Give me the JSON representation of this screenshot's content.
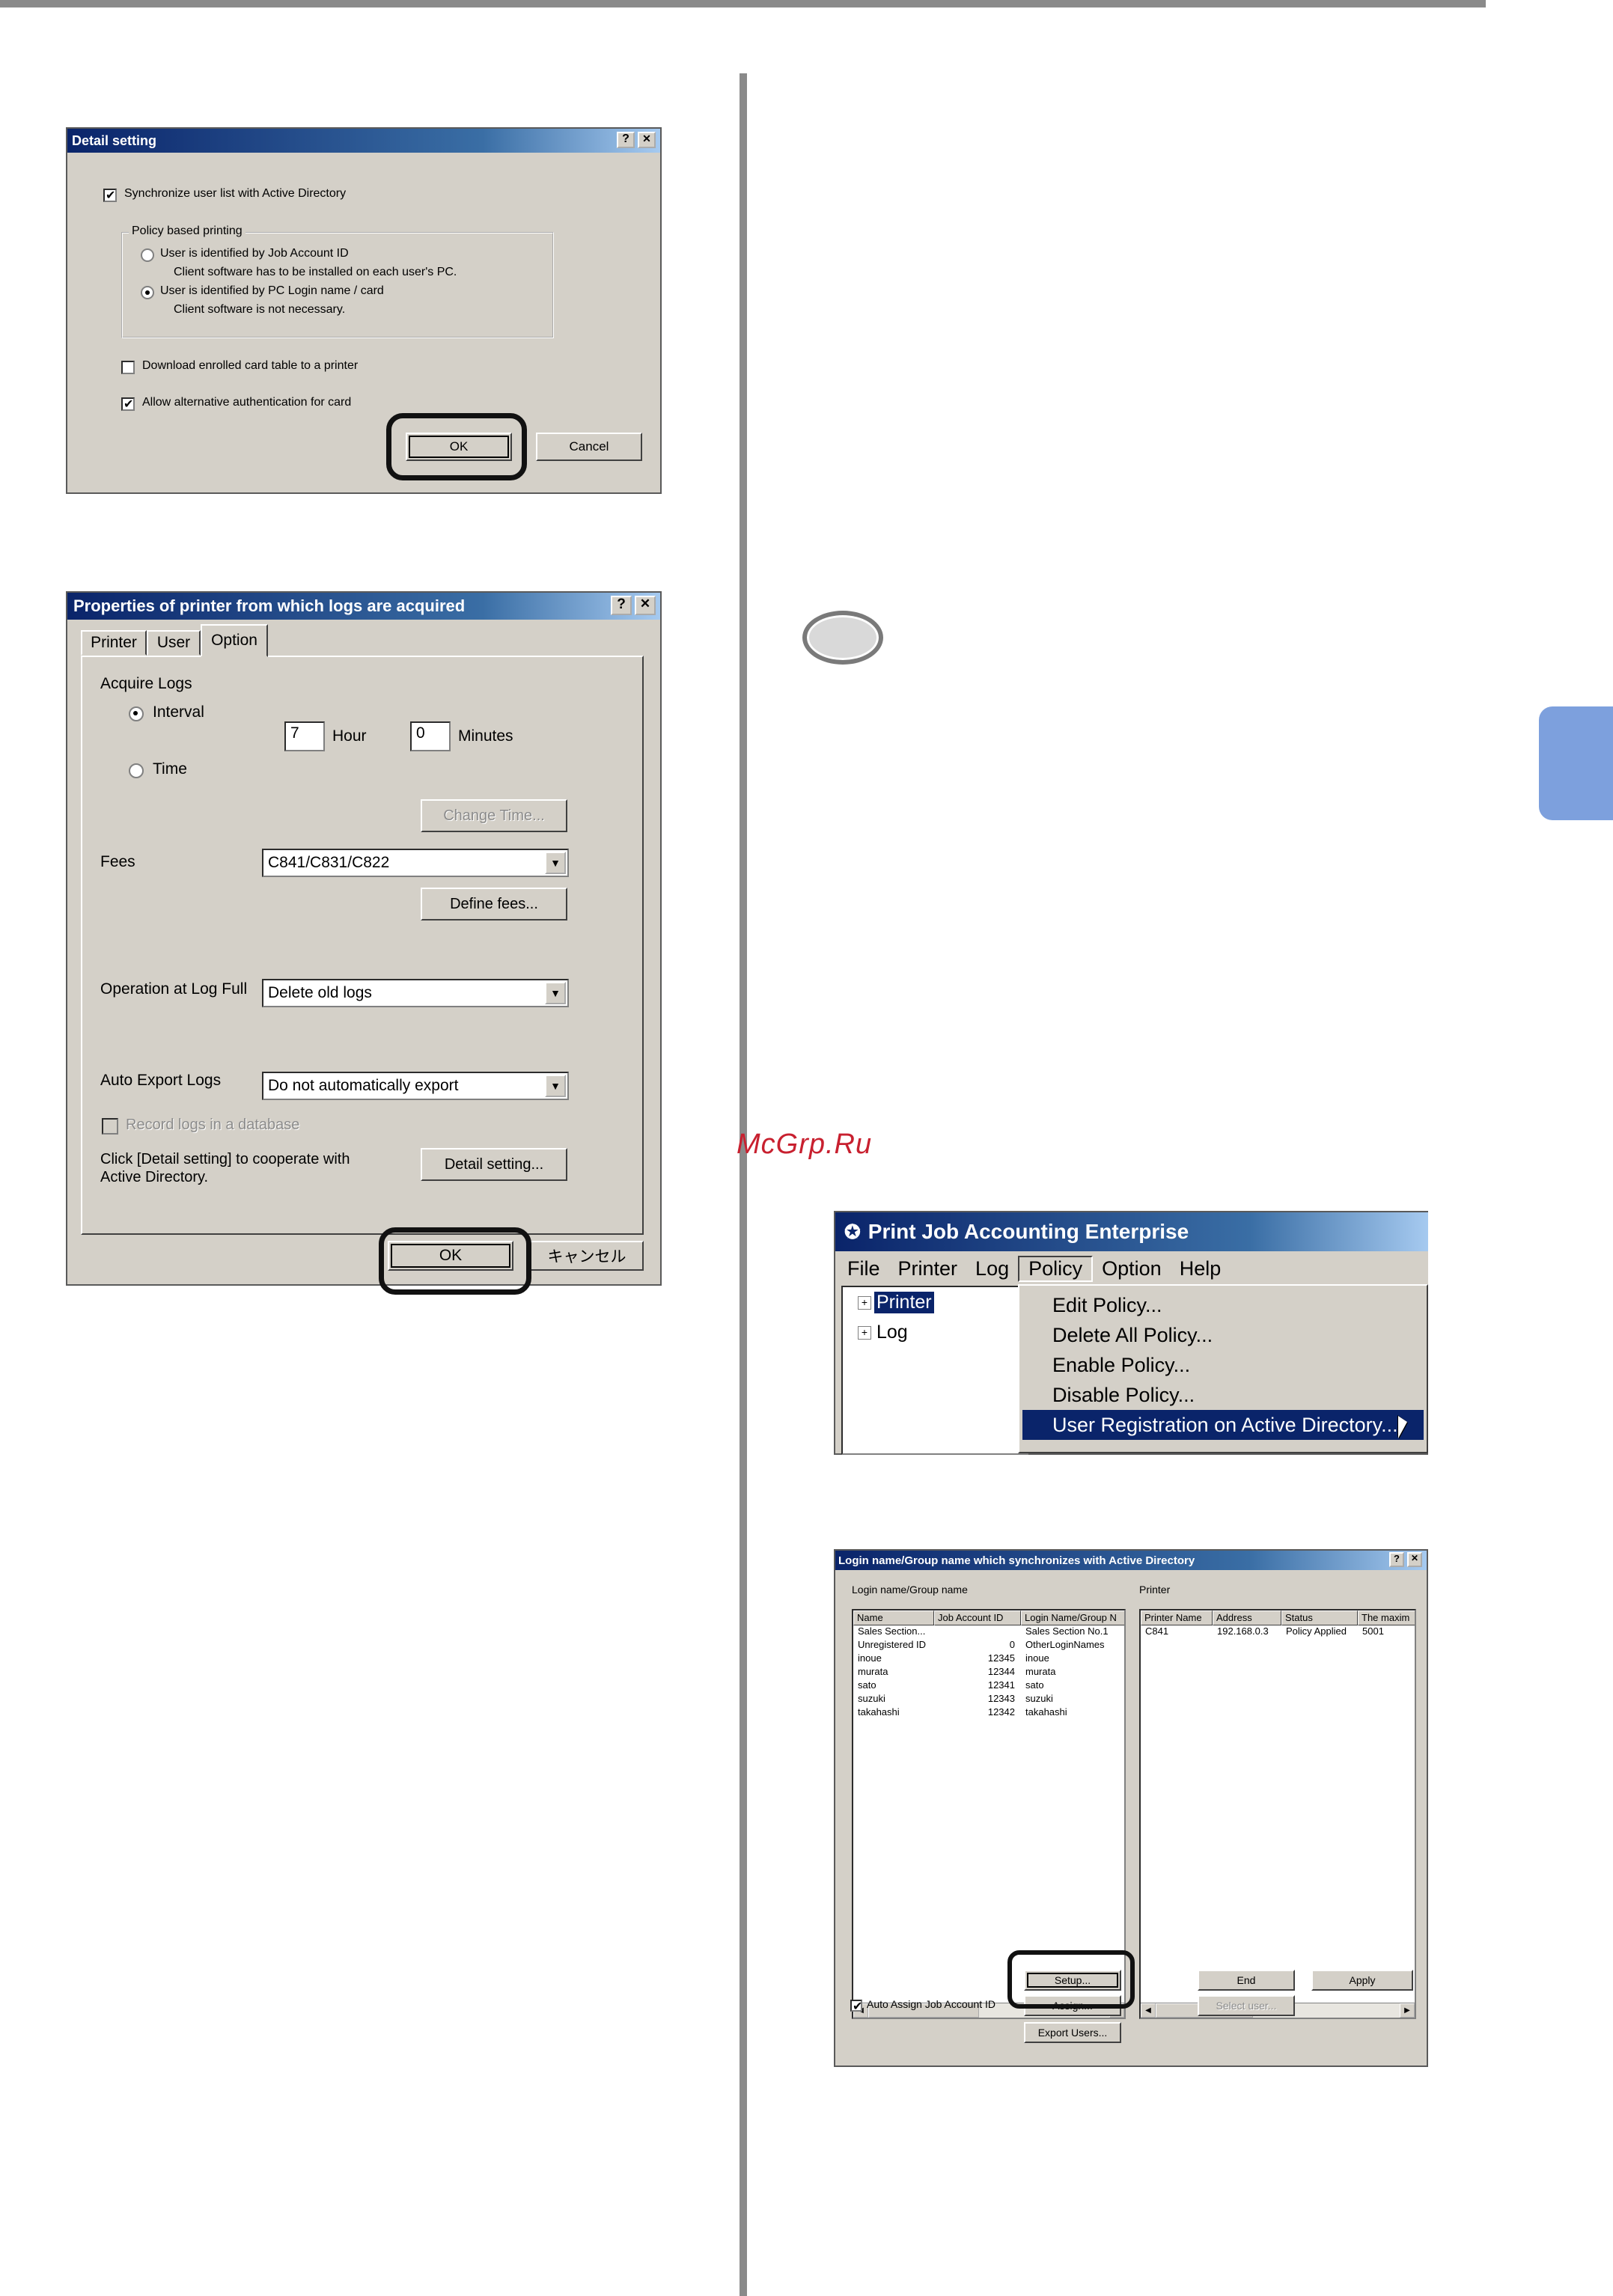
{
  "page": {
    "watermark": "McGrp.Ru"
  },
  "detail_setting": {
    "title": "Detail setting",
    "help_btn": "?",
    "close_btn": "✕",
    "sync_ad": "Synchronize user list with Active Directory",
    "sync_ad_checked": true,
    "policy_group": "Policy based printing",
    "radio_job_id": "User is identified by Job Account ID",
    "radio_job_id_note": "Client software has to be installed on each user's PC.",
    "radio_pc_login": "User is identified by PC Login name / card",
    "radio_pc_login_note": "Client software is not necessary.",
    "radio_selected": "pc_login",
    "download_card": "Download enrolled card table to a printer",
    "download_card_checked": false,
    "alt_auth": "Allow alternative authentication for card",
    "alt_auth_checked": true,
    "ok": "OK",
    "cancel": "Cancel"
  },
  "properties": {
    "title": "Properties of printer from which logs are acquired",
    "help_btn": "?",
    "close_btn": "✕",
    "tabs": [
      {
        "label": "Printer"
      },
      {
        "label": "User"
      },
      {
        "label": "Option"
      }
    ],
    "active_tab": "Option",
    "acquire_logs": "Acquire Logs",
    "interval": "Interval",
    "interval_selected": true,
    "hour_value": "7",
    "hour_label": "Hour",
    "minutes_value": "0",
    "minutes_label": "Minutes",
    "time": "Time",
    "change_time": "Change Time...",
    "fees_label": "Fees",
    "fees_value": "C841/C831/C822",
    "define_fees": "Define fees...",
    "op_log_full_label": "Operation at Log Full",
    "op_log_full_value": "Delete old logs",
    "auto_export_label": "Auto Export Logs",
    "auto_export_value": "Do not automatically export",
    "record_db": "Record logs in a database",
    "detail_note_line1": "Click [Detail setting] to cooperate with",
    "detail_note_line2": "Active Directory.",
    "detail_setting_btn": "Detail setting...",
    "ok": "OK",
    "cancel": "キャンセル"
  },
  "pjae": {
    "title": "Print Job Accounting Enterprise",
    "menu": [
      {
        "label": "File"
      },
      {
        "label": "Printer"
      },
      {
        "label": "Log"
      },
      {
        "label": "Policy"
      },
      {
        "label": "Option"
      },
      {
        "label": "Help"
      }
    ],
    "tree": [
      {
        "label": "Printer",
        "selected": true
      },
      {
        "label": "Log",
        "selected": false
      }
    ],
    "policy_menu": [
      {
        "label": "Edit Policy...",
        "active": false
      },
      {
        "label": "Delete All Policy...",
        "active": false
      },
      {
        "label": "Enable Policy...",
        "active": false
      },
      {
        "label": "Disable Policy...",
        "active": false
      },
      {
        "label": "User Registration on Active Directory...",
        "active": true
      }
    ]
  },
  "sync_dialog": {
    "title": "Login name/Group name which synchronizes with Active Directory",
    "help_btn": "?",
    "close_btn": "✕",
    "left_label": "Login name/Group name",
    "right_label": "Printer",
    "left_columns": [
      "Name",
      "Job Account ID",
      "Login Name/Group N"
    ],
    "left_rows": [
      [
        "Sales Section...",
        "",
        "Sales Section No.1"
      ],
      [
        "Unregistered ID",
        "0",
        "OtherLoginNames"
      ],
      [
        "inoue",
        "12345",
        "inoue"
      ],
      [
        "murata",
        "12344",
        "murata"
      ],
      [
        "sato",
        "12341",
        "sato"
      ],
      [
        "suzuki",
        "12343",
        "suzuki"
      ],
      [
        "takahashi",
        "12342",
        "takahashi"
      ]
    ],
    "right_columns": [
      "Printer Name",
      "Address",
      "Status",
      "The maxim"
    ],
    "right_rows": [
      [
        "C841",
        "192.168.0.3",
        "Policy Applied",
        "5001"
      ]
    ],
    "setup": "Setup...",
    "end": "End",
    "apply": "Apply",
    "auto_assign": "Auto Assign Job Account ID",
    "auto_assign_checked": true,
    "assign": "Assign...",
    "select_user": "Select user...",
    "export_users": "Export Users..."
  }
}
